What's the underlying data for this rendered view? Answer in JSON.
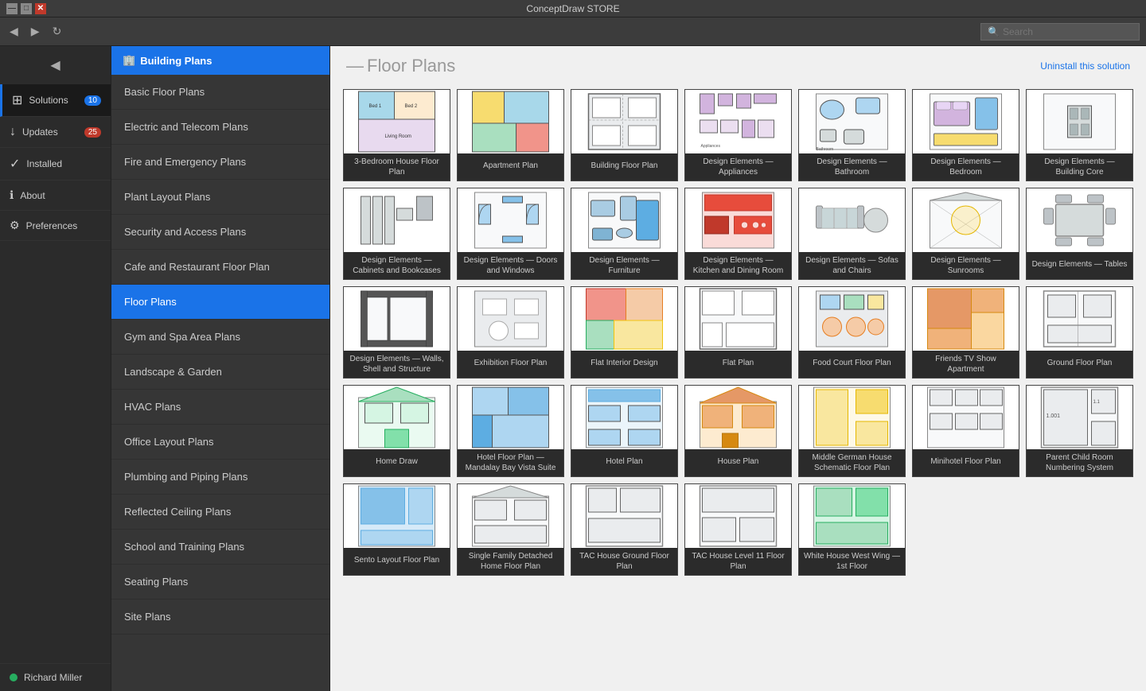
{
  "app": {
    "title": "ConceptDraw STORE",
    "search_placeholder": "Search"
  },
  "titlebar": {
    "minimize": "—",
    "maximize": "□",
    "close": "✕"
  },
  "toolbar": {
    "back": "◀",
    "forward": "▶",
    "refresh": "↻"
  },
  "left_sidebar": {
    "items": [
      {
        "id": "nav",
        "icon": "◀",
        "label": ""
      },
      {
        "id": "solutions",
        "icon": "⊞",
        "label": "Solutions",
        "badge": "10",
        "badge_color": "blue"
      },
      {
        "id": "updates",
        "icon": "↓",
        "label": "Updates",
        "badge": "25",
        "badge_color": "red"
      },
      {
        "id": "installed",
        "icon": "✓",
        "label": "Installed"
      },
      {
        "id": "about",
        "icon": "ℹ",
        "label": "About"
      },
      {
        "id": "preferences",
        "icon": "⚙",
        "label": "Preferences"
      }
    ],
    "user": {
      "name": "Richard Miller"
    }
  },
  "nav_panel": {
    "header": "Building Plans",
    "items": [
      {
        "id": "basic",
        "label": "Basic Floor Plans"
      },
      {
        "id": "electric",
        "label": "Electric and Telecom Plans"
      },
      {
        "id": "fire",
        "label": "Fire and Emergency Plans"
      },
      {
        "id": "plant",
        "label": "Plant Layout Plans"
      },
      {
        "id": "security",
        "label": "Security and Access Plans"
      },
      {
        "id": "cafe",
        "label": "Cafe and Restaurant Floor Plan"
      },
      {
        "id": "floor",
        "label": "Floor Plans",
        "active": true
      },
      {
        "id": "gym",
        "label": "Gym and Spa Area Plans"
      },
      {
        "id": "landscape",
        "label": "Landscape & Garden"
      },
      {
        "id": "hvac",
        "label": "HVAC Plans"
      },
      {
        "id": "office",
        "label": "Office Layout Plans"
      },
      {
        "id": "plumbing",
        "label": "Plumbing and Piping Plans"
      },
      {
        "id": "reflected",
        "label": "Reflected Ceiling Plans"
      },
      {
        "id": "school",
        "label": "School and Training Plans"
      },
      {
        "id": "seating",
        "label": "Seating Plans"
      },
      {
        "id": "site",
        "label": "Site Plans"
      }
    ]
  },
  "content": {
    "title": "Floor Plans",
    "uninstall_text": "Uninstall this solution",
    "grid_items": [
      {
        "id": 1,
        "label": "3-Bedroom House Floor Plan",
        "color1": "#a8d8ea",
        "color2": "#e8f4fd"
      },
      {
        "id": 2,
        "label": "Apartment Plan",
        "color1": "#f7dc6f",
        "color2": "#fdebd0"
      },
      {
        "id": 3,
        "label": "Building Floor Plan",
        "color1": "#d5dbdb",
        "color2": "#eaecee"
      },
      {
        "id": 4,
        "label": "Design Elements — Appliances",
        "color1": "#d2b4de",
        "color2": "#f5eef8"
      },
      {
        "id": 5,
        "label": "Design Elements — Bathroom",
        "color1": "#d5dbdb",
        "color2": "#eaecee"
      },
      {
        "id": 6,
        "label": "Design Elements — Bedroom",
        "color1": "#d5dbdb",
        "color2": "#eaecee"
      },
      {
        "id": 7,
        "label": "Design Elements — Building Core",
        "color1": "#d5dbdb",
        "color2": "#eaecee"
      },
      {
        "id": 8,
        "label": "Design Elements — Cabinets and Bookcases",
        "color1": "#d5dbdb",
        "color2": "#eaecee"
      },
      {
        "id": 9,
        "label": "Design Elements — Doors and Windows",
        "color1": "#d5dbdb",
        "color2": "#eaecee"
      },
      {
        "id": 10,
        "label": "Design Elements — Furniture",
        "color1": "#a9cce3",
        "color2": "#eaf2f8"
      },
      {
        "id": 11,
        "label": "Design Elements — Kitchen and Dining Room",
        "color1": "#c0392b",
        "color2": "#fadbd8"
      },
      {
        "id": 12,
        "label": "Design Elements — Sofas and Chairs",
        "color1": "#d5dbdb",
        "color2": "#eaecee"
      },
      {
        "id": 13,
        "label": "Design Elements — Sunrooms",
        "color1": "#d5dbdb",
        "color2": "#eaecee"
      },
      {
        "id": 14,
        "label": "Design Elements — Tables",
        "color1": "#d5dbdb",
        "color2": "#eaecee"
      },
      {
        "id": 15,
        "label": "Design Elements — Walls, Shell and Structure",
        "color1": "#d5dbdb",
        "color2": "#eaecee"
      },
      {
        "id": 16,
        "label": "Exhibition Floor Plan",
        "color1": "#d5dbdb",
        "color2": "#eaecee"
      },
      {
        "id": 17,
        "label": "Flat Interior Design",
        "color1": "#f1948a",
        "color2": "#fce8e6"
      },
      {
        "id": 18,
        "label": "Flat Plan",
        "color1": "#d5dbdb",
        "color2": "#eaecee"
      },
      {
        "id": 19,
        "label": "Food Court Floor Plan",
        "color1": "#d5dbdb",
        "color2": "#eaecee"
      },
      {
        "id": 20,
        "label": "Friends TV Show Apartment",
        "color1": "#e59866",
        "color2": "#fdebd0"
      },
      {
        "id": 21,
        "label": "Ground Floor Plan",
        "color1": "#d5dbdb",
        "color2": "#eaecee"
      },
      {
        "id": 22,
        "label": "Home Draw",
        "color1": "#a9dfbf",
        "color2": "#eafaf1"
      },
      {
        "id": 23,
        "label": "Hotel Floor Plan — Mandalay Bay Vista Suite",
        "color1": "#aed6f1",
        "color2": "#ebf5fb"
      },
      {
        "id": 24,
        "label": "Hotel Plan",
        "color1": "#85c1e9",
        "color2": "#ebf5fb"
      },
      {
        "id": 25,
        "label": "House Plan",
        "color1": "#e59866",
        "color2": "#fdebd0"
      },
      {
        "id": 26,
        "label": "Middle German House Schematic Floor Plan",
        "color1": "#f9e79f",
        "color2": "#fef9e7"
      },
      {
        "id": 27,
        "label": "Minihotel Floor Plan",
        "color1": "#d5dbdb",
        "color2": "#eaecee"
      },
      {
        "id": 28,
        "label": "Parent Child Room Numbering System",
        "color1": "#d5dbdb",
        "color2": "#eaecee"
      },
      {
        "id": 29,
        "label": "Sento Layout Floor Plan",
        "color1": "#85c1e9",
        "color2": "#d6eaf8"
      },
      {
        "id": 30,
        "label": "Single Family Detached Home Floor Plan",
        "color1": "#d5dbdb",
        "color2": "#eaecee"
      },
      {
        "id": 31,
        "label": "TAC House Ground Floor Plan",
        "color1": "#d5dbdb",
        "color2": "#eaecee"
      },
      {
        "id": 32,
        "label": "TAC House Level 11 Floor Plan",
        "color1": "#d5dbdb",
        "color2": "#eaecee"
      },
      {
        "id": 33,
        "label": "White House West Wing — 1st Floor",
        "color1": "#a9dfbf",
        "color2": "#d5f5e3"
      }
    ]
  }
}
